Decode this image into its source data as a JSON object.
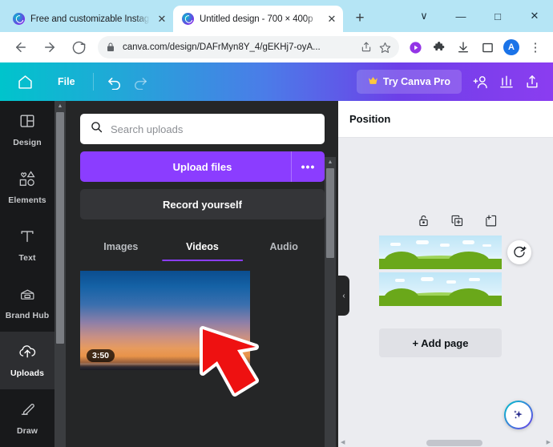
{
  "browser": {
    "tabs": [
      {
        "title": "Free and customizable Instag",
        "favicon": "canva-icon",
        "active": false,
        "close_label": "✕"
      },
      {
        "title": "Untitled design - 700 × 400p",
        "favicon": "canva-icon",
        "active": true,
        "close_label": "✕"
      }
    ],
    "new_tab_label": "+",
    "window_controls": [
      {
        "name": "tab-search-button",
        "glyph": "∨"
      },
      {
        "name": "minimize-button",
        "glyph": "—"
      },
      {
        "name": "maximize-button",
        "glyph": "□"
      },
      {
        "name": "close-button",
        "glyph": "✕"
      }
    ],
    "toolbar": {
      "back_label": "←",
      "forward_label": "→",
      "reload_label": "↻",
      "url": "canva.com/design/DAFrMyn8Y_4/gEKHj7-oyA...",
      "lock_icon": "lock-icon",
      "share_icon": "share-icon",
      "bookmark_icon": "star-icon",
      "extension_icons": [
        "media-play-icon",
        "extensions-puzzle-icon",
        "downloads-icon",
        "side-panel-icon"
      ],
      "avatar_letter": "A",
      "menu_label": "⋮"
    }
  },
  "canva_header": {
    "home_icon": "home-icon",
    "file_label": "File",
    "undo_icon": "undo-icon",
    "redo_icon": "redo-icon",
    "pro_label": "Try Canva Pro",
    "crown_icon": "crown-icon",
    "share_people_icon": "add-collaborator-icon",
    "insights_icon": "insights-bar-chart-icon",
    "export_icon": "share-export-icon",
    "gradient_start": "#00c4cc",
    "gradient_end": "#8b3df0"
  },
  "rail": {
    "items": [
      {
        "label": "Design",
        "icon": "design-layout-icon",
        "active": false
      },
      {
        "label": "Elements",
        "icon": "elements-shapes-icon",
        "active": false
      },
      {
        "label": "Text",
        "icon": "text-t-icon",
        "active": false
      },
      {
        "label": "Brand Hub",
        "icon": "brand-hub-icon",
        "active": false
      },
      {
        "label": "Uploads",
        "icon": "upload-cloud-icon",
        "active": true
      },
      {
        "label": "Draw",
        "icon": "draw-pen-icon",
        "active": false
      }
    ],
    "scroll_up_glyph": "▲"
  },
  "uploads_panel": {
    "search": {
      "placeholder": "Search uploads",
      "value": "",
      "icon": "search-icon"
    },
    "upload_button": {
      "label": "Upload files",
      "color": "#8b3dff"
    },
    "upload_more_label": "•••",
    "record_button": {
      "label": "Record yourself"
    },
    "tabs": [
      {
        "label": "Images",
        "active": false
      },
      {
        "label": "Videos",
        "active": true
      },
      {
        "label": "Audio",
        "active": false
      }
    ],
    "videos": [
      {
        "duration": "3:50",
        "name": "sunset-video-thumbnail"
      }
    ],
    "scroll_up_glyph": "▲",
    "collapse_glyph": "‹"
  },
  "editor": {
    "panel_title": "Position",
    "page_tools": [
      {
        "name": "lock-icon",
        "glyph": "lock"
      },
      {
        "name": "duplicate-page-icon",
        "glyph": "duplicate"
      },
      {
        "name": "add-page-icon",
        "glyph": "addpage"
      }
    ],
    "pages": [
      {
        "name": "page-thumbnail-1"
      },
      {
        "name": "page-thumbnail-2"
      }
    ],
    "rotate_button": {
      "name": "animate-rotate-button",
      "glyph": "↻"
    },
    "add_page_label": "+ Add page",
    "ai_button": {
      "name": "magic-ai-button",
      "glyph": "✦"
    },
    "hscroll_left_glyph": "◀",
    "hscroll_right_glyph": "▶"
  },
  "cursor": {
    "name": "red-arrow-cursor",
    "color": "#ee1111"
  }
}
